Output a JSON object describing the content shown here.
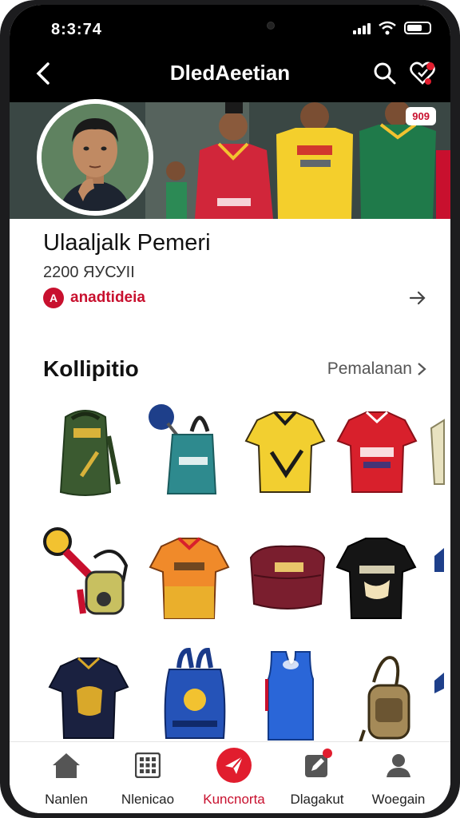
{
  "status": {
    "time": "8:3:74"
  },
  "nav": {
    "title": "DledAeetian"
  },
  "banner": {
    "badge": "909"
  },
  "profile": {
    "name": "Ulaaljalk Pemeri",
    "stat": "2200 ЯУСУІІ",
    "brand": "anadtideia",
    "brand_logo_text": "A"
  },
  "section": {
    "title": "Kollipitio",
    "link": "Pemalanan"
  },
  "products": [
    {
      "icon": "green-backpack"
    },
    {
      "icon": "teal-bag-with-tag"
    },
    {
      "icon": "yellow-jersey"
    },
    {
      "icon": "red-jersey"
    },
    {
      "icon": "lanyard-keychain"
    },
    {
      "icon": "orange-jersey"
    },
    {
      "icon": "maroon-waist-bag"
    },
    {
      "icon": "black-tshirt"
    },
    {
      "icon": "navy-jersey"
    },
    {
      "icon": "blue-backpack"
    },
    {
      "icon": "blue-tank-top"
    },
    {
      "icon": "khaki-sling-bag"
    }
  ],
  "tabs": [
    {
      "label": "Nanlen",
      "icon": "home-icon"
    },
    {
      "label": "Nlenicao",
      "icon": "grid-icon"
    },
    {
      "label": "Kuncnorta",
      "icon": "plane-icon",
      "active": true
    },
    {
      "label": "Dlagakut",
      "icon": "edit-icon"
    },
    {
      "label": "Woegain",
      "icon": "user-icon"
    }
  ],
  "colors": {
    "accent": "#c8102e",
    "topbar": "#000000"
  }
}
